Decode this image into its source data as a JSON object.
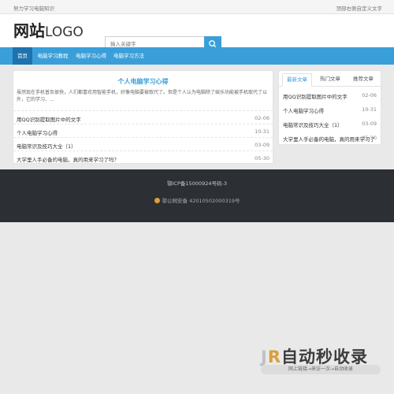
{
  "topbar": {
    "left_text": "努力学习电脑知识",
    "right_text": "顶部右侧自定义文字"
  },
  "header": {
    "logo_bold": "网站",
    "logo_light": "LOGO",
    "search_placeholder": "输入关键字"
  },
  "nav": {
    "items": [
      {
        "label": "首页",
        "active": true
      },
      {
        "label": "电脑学习教程"
      },
      {
        "label": "电脑学习心得"
      },
      {
        "label": "电脑学习方法"
      }
    ]
  },
  "main": {
    "title": "个人电脑学习心得",
    "summary": "虽然现在手机普及很快，人们都喜欢用智能手机，好像电脑要被取代了。但是个人认为电脑除了娱乐功能被手机取代了以外，它的学习、...",
    "list": [
      {
        "title": "用QQ识别提取图片中的文字",
        "date": "02-06"
      },
      {
        "title": "个人电脑学习心得",
        "date": "10-31"
      },
      {
        "title": "电脑常识及技巧大全（1）",
        "date": "03-09"
      },
      {
        "title": "大学里人手必备的电脑，真的用来学习了吗？",
        "date": "05-30"
      }
    ]
  },
  "sidebar": {
    "tabs": [
      {
        "label": "最新文章",
        "active": true
      },
      {
        "label": "热门文章"
      },
      {
        "label": "推荐文章"
      }
    ],
    "list": [
      {
        "title": "用QQ识别提取图片中的文字",
        "date": "02-06"
      },
      {
        "title": "个人电脑学习心得",
        "date": "10-31"
      },
      {
        "title": "电脑常识及技巧大全（1）",
        "date": "03-09"
      },
      {
        "title": "大学里人手必备的电脑，真的用来学习了",
        "date": "05-30"
      }
    ]
  },
  "footer": {
    "icp": "鄂ICP备15000924号码-3",
    "gongan": "鄂公网安备 42010502000319号"
  },
  "watermark": {
    "logo_j": "J",
    "logo_r": "R",
    "logo_text": "自动秒收录",
    "sub": "网上链接→来访一次→自动收录"
  },
  "colors": {
    "accent": "#3a9fd9",
    "nav_active": "#1d73ad",
    "footer_bg": "#2c2f33"
  }
}
